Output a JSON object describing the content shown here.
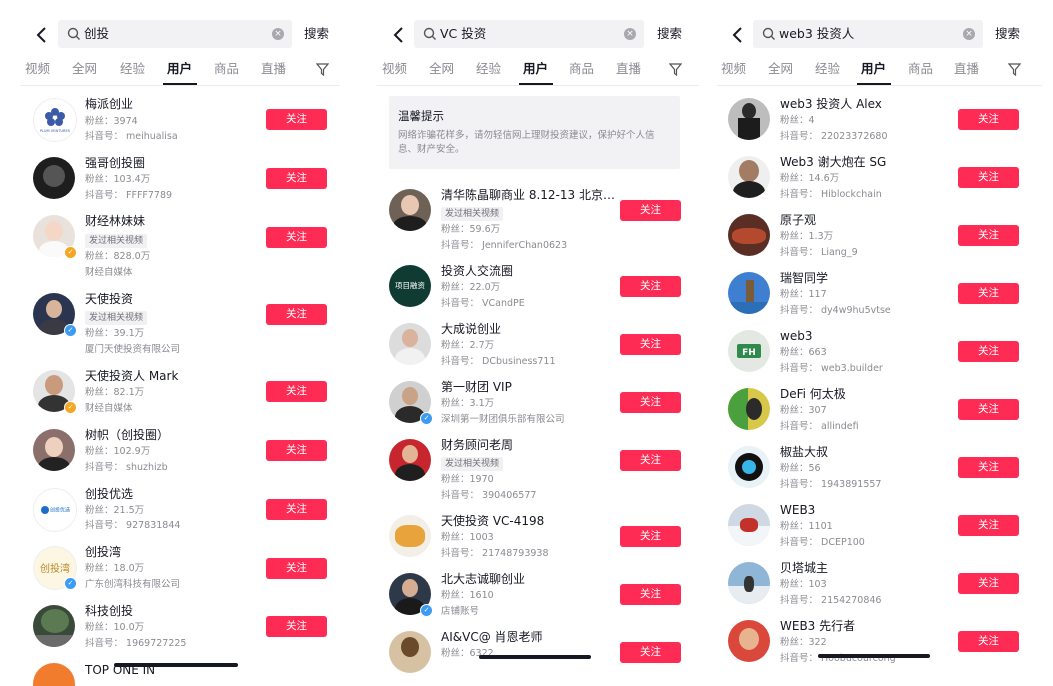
{
  "ui": {
    "search_btn": "搜索",
    "follow": "关注",
    "clear_glyph": "×"
  },
  "panels": [
    {
      "query": "创投",
      "tabs": [
        "视频",
        "全网",
        "经验",
        "用户",
        "商品",
        "直播"
      ],
      "active_tab": "用户",
      "users": [
        {
          "name": "梅派创业",
          "fans": "粉丝：3974",
          "id": "抖音号： meihualisa",
          "avatar_text": "PLUM VENTURES"
        },
        {
          "name": "强哥创投圈",
          "fans": "粉丝：103.4万",
          "id": "抖音号： FFFF7789"
        },
        {
          "name": "财经林妹妹",
          "tag": "发过相关视频",
          "fans": "粉丝：828.0万",
          "extra": "财经自媒体"
        },
        {
          "name": "天使投资",
          "tag": "发过相关视频",
          "fans": "粉丝：39.1万",
          "extra": "厦门天使投资有限公司"
        },
        {
          "name": "天使投资人 Mark",
          "fans": "粉丝：82.1万",
          "extra": "财经自媒体"
        },
        {
          "name": "树帜（创投圈）",
          "fans": "粉丝：102.9万",
          "id": "抖音号： shuzhizb"
        },
        {
          "name": "创投优选",
          "fans": "粉丝：21.5万",
          "id": "抖音号： 927831844",
          "avatar_text": "创投优选"
        },
        {
          "name": "创投湾",
          "fans": "粉丝：18.0万",
          "extra": "广东创湾科技有限公司",
          "avatar_text": "创投湾"
        },
        {
          "name": "科技创投",
          "fans": "粉丝：10.0万",
          "id": "抖音号： 1969727225"
        },
        {
          "name": "TOP ONE IN"
        }
      ]
    },
    {
      "query": "VC 投资",
      "tabs": [
        "视频",
        "全网",
        "经验",
        "用户",
        "商品",
        "直播"
      ],
      "active_tab": "用户",
      "tip": {
        "title": "温馨提示",
        "body": "网络诈骗花样多，请勿轻信网上理财投资建议，保护好个人信息、财产安全。"
      },
      "users": [
        {
          "name": "清华陈晶聊商业 8.12-13 北京…",
          "tag": "发过相关视频",
          "fans": "粉丝：59.6万",
          "id": "抖音号： JenniferChan0623"
        },
        {
          "name": "投资人交流圈",
          "fans": "粉丝：22.0万",
          "id": "抖音号： VCandPE",
          "avatar_text": "项目融资"
        },
        {
          "name": "大成说创业",
          "fans": "粉丝：2.7万",
          "id": "抖音号： DCbusiness711"
        },
        {
          "name": "第一财团 VIP",
          "fans": "粉丝：3.1万",
          "extra": "深圳第一财团俱乐部有限公司"
        },
        {
          "name": "财务顾问老周",
          "tag": "发过相关视频",
          "fans": "粉丝：1970",
          "id": "抖音号： 390406577"
        },
        {
          "name": "天使投资 VC-4198",
          "fans": "粉丝：1003",
          "id": "抖音号： 21748793938"
        },
        {
          "name": "北大志诚聊创业",
          "fans": "粉丝：1610",
          "extra": "店铺账号"
        },
        {
          "name": "AI&VC@ 肖恩老师",
          "fans": "粉丝：6322"
        }
      ]
    },
    {
      "query": "web3 投资人",
      "tabs": [
        "视频",
        "全网",
        "经验",
        "用户",
        "商品",
        "直播"
      ],
      "active_tab": "用户",
      "users": [
        {
          "name": "web3 投资人 Alex",
          "fans": "粉丝：4",
          "id": "抖音号： 22023372680"
        },
        {
          "name": "Web3 谢大炮在 SG",
          "fans": "粉丝：14.6万",
          "id": "抖音号： Hiblockchain"
        },
        {
          "name": "原子观",
          "fans": "粉丝：1.3万",
          "id": "抖音号： Liang_9"
        },
        {
          "name": "瑞智同学",
          "fans": "粉丝：117",
          "id": "抖音号： dy4w9hu5vtse"
        },
        {
          "name": "web3",
          "fans": "粉丝：663",
          "id": "抖音号： web3.builder",
          "avatar_text": "FH"
        },
        {
          "name": "DeFi 何太极",
          "fans": "粉丝：307",
          "id": "抖音号： allindefi"
        },
        {
          "name": "椒盐大叔",
          "fans": "粉丝：56",
          "id": "抖音号： 1943891557"
        },
        {
          "name": "WEB3",
          "fans": "粉丝：1101",
          "id": "抖音号： DCEP100"
        },
        {
          "name": "贝塔城主",
          "fans": "粉丝：103",
          "id": "抖音号： 2154270846"
        },
        {
          "name": "WEB3 先行者",
          "fans": "粉丝：322",
          "id": "抖音号： Hoobucourcong"
        }
      ]
    }
  ]
}
